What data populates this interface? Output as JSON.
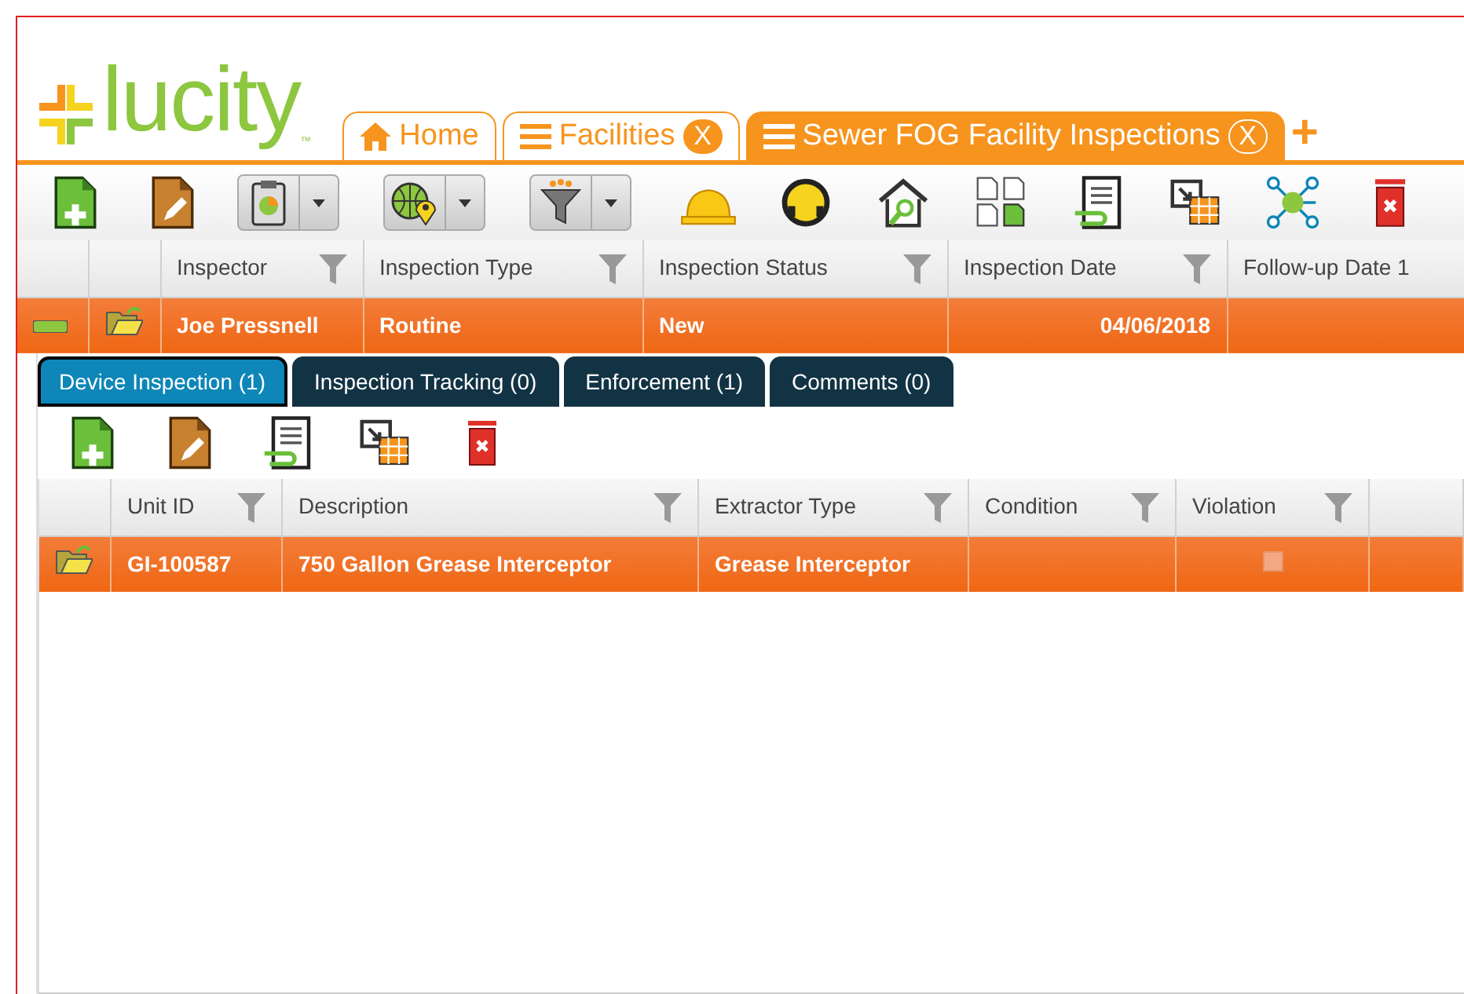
{
  "logo": {
    "text": "lucity",
    "trademark": "™"
  },
  "tabs": [
    {
      "label": "Home",
      "kind": "home",
      "selected": false
    },
    {
      "label": "Facilities",
      "kind": "list",
      "close": "X",
      "selected": false
    },
    {
      "label": "Sewer FOG Facility Inspections",
      "kind": "list",
      "close": "X",
      "selected": true
    }
  ],
  "add_tab": "+",
  "toolbar": [
    {
      "kind": "new",
      "dropdown": false
    },
    {
      "kind": "edit",
      "dropdown": false
    },
    {
      "kind": "report",
      "dropdown": true
    },
    {
      "kind": "map",
      "dropdown": true
    },
    {
      "kind": "filter",
      "dropdown": true
    },
    {
      "kind": "hardhat",
      "dropdown": false
    },
    {
      "kind": "headset",
      "dropdown": false
    },
    {
      "kind": "house-search",
      "dropdown": false
    },
    {
      "kind": "copy",
      "dropdown": false
    },
    {
      "kind": "link-doc",
      "dropdown": false
    },
    {
      "kind": "export",
      "dropdown": false
    },
    {
      "kind": "network",
      "dropdown": false
    },
    {
      "kind": "delete",
      "dropdown": false
    }
  ],
  "grid": {
    "columns": [
      {
        "label": "Inspector",
        "filter": true
      },
      {
        "label": "Inspection Type",
        "filter": true
      },
      {
        "label": "Inspection Status",
        "filter": true
      },
      {
        "label": "Inspection Date",
        "filter": true
      },
      {
        "label": "Follow-up Date 1",
        "filter": false
      }
    ],
    "rows": [
      {
        "expanded": true,
        "selected": true,
        "cells": [
          "Joe Pressnell",
          "Routine",
          "New",
          "04/06/2018",
          ""
        ]
      }
    ]
  },
  "sub_tabs": [
    {
      "label": "Device Inspection (1)",
      "selected": true
    },
    {
      "label": "Inspection Tracking (0)",
      "selected": false
    },
    {
      "label": "Enforcement (1)",
      "selected": false
    },
    {
      "label": "Comments (0)",
      "selected": false
    }
  ],
  "sub_toolbar": [
    {
      "kind": "new"
    },
    {
      "kind": "edit"
    },
    {
      "kind": "link-doc"
    },
    {
      "kind": "export"
    },
    {
      "kind": "delete"
    }
  ],
  "sub_grid": {
    "columns": [
      {
        "label": "Unit ID",
        "filter": true
      },
      {
        "label": "Description",
        "filter": true
      },
      {
        "label": "Extractor Type",
        "filter": true
      },
      {
        "label": "Condition",
        "filter": true
      },
      {
        "label": "Violation",
        "filter": true
      }
    ],
    "rows": [
      {
        "selected": true,
        "unit_id": "GI-100587",
        "description": "750 Gallon Grease Interceptor",
        "extractor_type": "Grease Interceptor",
        "condition": "",
        "violation": false
      }
    ]
  }
}
